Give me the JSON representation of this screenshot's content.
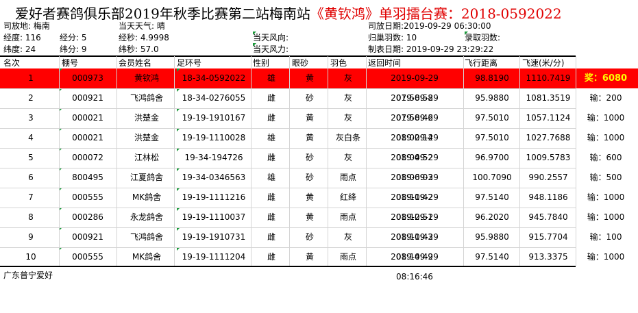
{
  "title": {
    "main": "爱好者赛鸽俱乐部2019年秋季比赛第二站梅南站",
    "highlight": "《黄钦鸿》单羽擂台赛：2018-0592022"
  },
  "info": {
    "release_place": "司放地: 梅南",
    "weather": "当天天气: 晴",
    "release_date": "司放日期:2019-09-29 06:30:00",
    "longitude": "经度: 116",
    "long_min": "经分: 5",
    "long_sec": "经秒: 4.9998",
    "wind_dir": "当天风向:",
    "returned": "归巢羽数: 10",
    "recorded": "录取羽数:",
    "latitude": "纬度:   24",
    "lat_min": "纬分: 9",
    "lat_sec": "纬秒: 57.0",
    "wind_force": "当天风力:",
    "created": "制表日期: 2019-09-29 23:29:22"
  },
  "headers": [
    "名次",
    "棚号",
    "会员姓名",
    "足环号",
    "性别",
    "眼砂",
    "羽色",
    "返回时间",
    "飞行距离",
    "飞速(米/分)"
  ],
  "rows": [
    {
      "rank": "1",
      "loft": "000973",
      "name": "黄钦鸿",
      "ring": "18-34-0592022",
      "sex": "雄",
      "eye": "黄",
      "color": "灰",
      "time": "2019-09-29 07:58:58",
      "dist": "98.8190",
      "speed": "1110.7419",
      "award": "奖：6080"
    },
    {
      "rank": "2",
      "loft": "000921",
      "name": "飞鸿鸽舍",
      "ring": "18-34-0276055",
      "sex": "雌",
      "eye": "砂",
      "color": "灰",
      "time": "2019-09-29 07:58:46",
      "dist": "95.9880",
      "speed": "1081.3519",
      "award": "输：200"
    },
    {
      "rank": "3",
      "loft": "000021",
      "name": "洪楚金",
      "ring": "19-19-1910167",
      "sex": "雌",
      "eye": "黄",
      "color": "灰",
      "time": "2019-09-29 08:02:14",
      "dist": "97.5010",
      "speed": "1057.1124",
      "award": "输：1000"
    },
    {
      "rank": "4",
      "loft": "000021",
      "name": "洪楚金",
      "ring": "19-19-1110028",
      "sex": "雄",
      "eye": "黄",
      "color": "灰白条",
      "time": "2019-09-29 08:04:52",
      "dist": "97.5010",
      "speed": "1027.7688",
      "award": "输：1000"
    },
    {
      "rank": "5",
      "loft": "000072",
      "name": "江林松",
      "ring": "19-34-194726",
      "sex": "雌",
      "eye": "砂",
      "color": "灰",
      "time": "2019-09-29 08:06:03",
      "dist": "96.9700",
      "speed": "1009.5783",
      "award": "输：600"
    },
    {
      "rank": "6",
      "loft": "800495",
      "name": "江夏鸽舍",
      "ring": "19-34-0346563",
      "sex": "雄",
      "eye": "砂",
      "color": "雨点",
      "time": "2019-09-29 08:11:42",
      "dist": "100.7090",
      "speed": "990.2557",
      "award": "输：500"
    },
    {
      "rank": "7",
      "loft": "000555",
      "name": "MK鸽舍",
      "ring": "19-19-1111216",
      "sex": "雌",
      "eye": "黄",
      "color": "红绛",
      "time": "2019-09-29 08:12:51",
      "dist": "97.5140",
      "speed": "948.1186",
      "award": "输：1000"
    },
    {
      "rank": "8",
      "loft": "000286",
      "name": "永龙鸽舍",
      "ring": "19-19-1110037",
      "sex": "雌",
      "eye": "黄",
      "color": "雨点",
      "time": "2019-09-29 08:11:43",
      "dist": "96.2020",
      "speed": "945.7840",
      "award": "输：1000"
    },
    {
      "rank": "9",
      "loft": "000921",
      "name": "飞鸿鸽舍",
      "ring": "19-19-1910731",
      "sex": "雌",
      "eye": "砂",
      "color": "灰",
      "time": "2019-09-29 08:14:49",
      "dist": "95.9880",
      "speed": "915.7704",
      "award": "输：100"
    },
    {
      "rank": "10",
      "loft": "000555",
      "name": "MK鸽舍",
      "ring": "19-19-1111204",
      "sex": "雌",
      "eye": "黄",
      "color": "雨点",
      "time": "2019-09-29 08:16:46",
      "dist": "97.5140",
      "speed": "913.3375",
      "award": "输：1000"
    }
  ],
  "footer": "广东普宁爱好",
  "colors": {
    "highlight_row": "#ff0000",
    "title_red": "#e00000",
    "award_yellow": "#ffff00",
    "marker_green": "#1a9a3a"
  }
}
